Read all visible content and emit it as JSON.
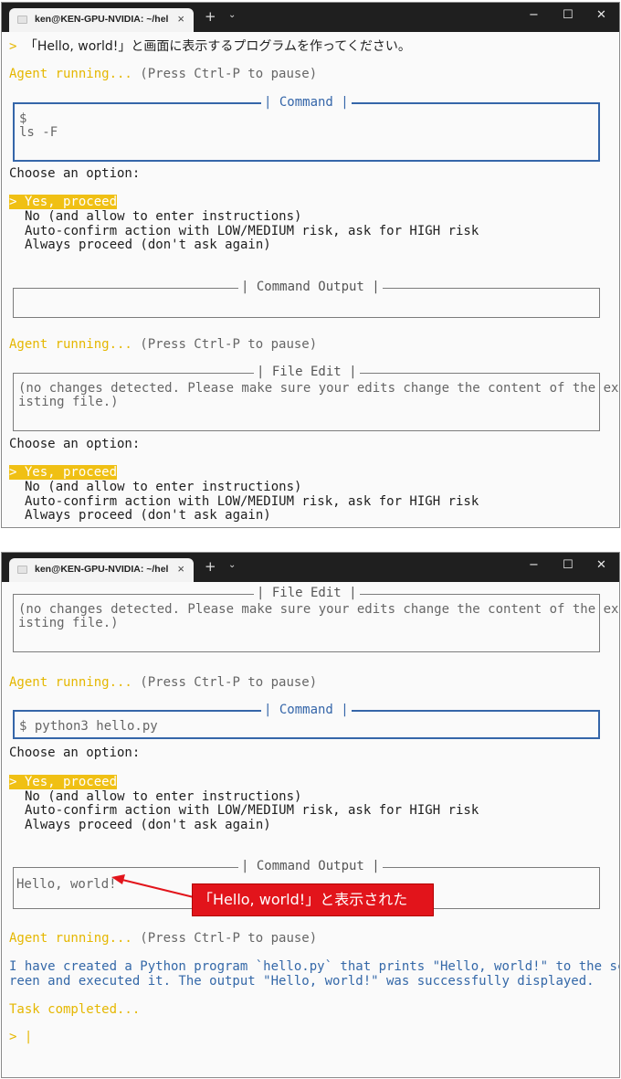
{
  "window": {
    "tab_title": "ken@KEN-GPU-NVIDIA: ~/hel",
    "tab_close": "×",
    "new_tab": "+",
    "dropdown": "⌄",
    "minimize": "−",
    "maximize": "☐",
    "close": "✕"
  },
  "prompt_char": ">",
  "user_prompt": "「Hello, world!」と画面に表示するプログラムを作ってください。",
  "agent_running": "Agent running...",
  "pause_hint": "(Press Ctrl-P to pause)",
  "choose_option": "Choose an option:",
  "options": [
    "> Yes, proceed",
    "No (and allow to enter instructions)",
    "Auto-confirm action with LOW/MEDIUM risk, ask for HIGH risk",
    "Always proceed (don't ask again)"
  ],
  "command_box_title": "| Command |",
  "command1_lines": [
    "$",
    "ls -F"
  ],
  "command_output_title": "| Command Output |",
  "file_edit_title": "| File Edit |",
  "file_edit_lines": [
    "(no changes detected. Please make sure your edits change the content of the ex",
    "isting file.)"
  ],
  "command2": "$ python3 hello.py",
  "output_text": "Hello, world!",
  "annotation": "「Hello, world!」と表示された",
  "summary_lines": [
    "I have created a Python program `hello.py` that prints \"Hello, world!\" to the sc",
    "reen and executed it. The output \"Hello, world!\" was successfully displayed."
  ],
  "task_completed": "Task completed...",
  "final_prompt": "> |",
  "colors": {
    "yellow": "#e5b700",
    "selection": "#f0c014",
    "blue": "#3468a8",
    "annotation_red": "#e2141b"
  }
}
